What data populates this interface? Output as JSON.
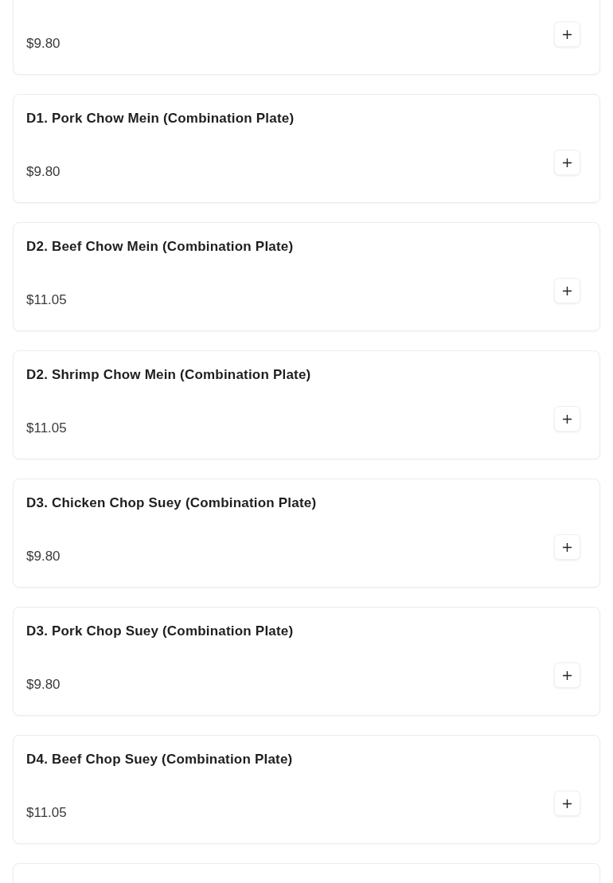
{
  "items": [
    {
      "price": "$9.80"
    },
    {
      "name": "D1. Pork Chow Mein (Combination Plate)",
      "price": "$9.80"
    },
    {
      "name": "D2. Beef Chow Mein (Combination Plate)",
      "price": "$11.05"
    },
    {
      "name": "D2. Shrimp Chow Mein (Combination Plate)",
      "price": "$11.05"
    },
    {
      "name": "D3. Chicken Chop Suey (Combination Plate)",
      "price": "$9.80"
    },
    {
      "name": "D3. Pork Chop Suey (Combination Plate)",
      "price": "$9.80"
    },
    {
      "name": "D4. Beef Chop Suey (Combination Plate)",
      "price": "$11.05"
    }
  ]
}
